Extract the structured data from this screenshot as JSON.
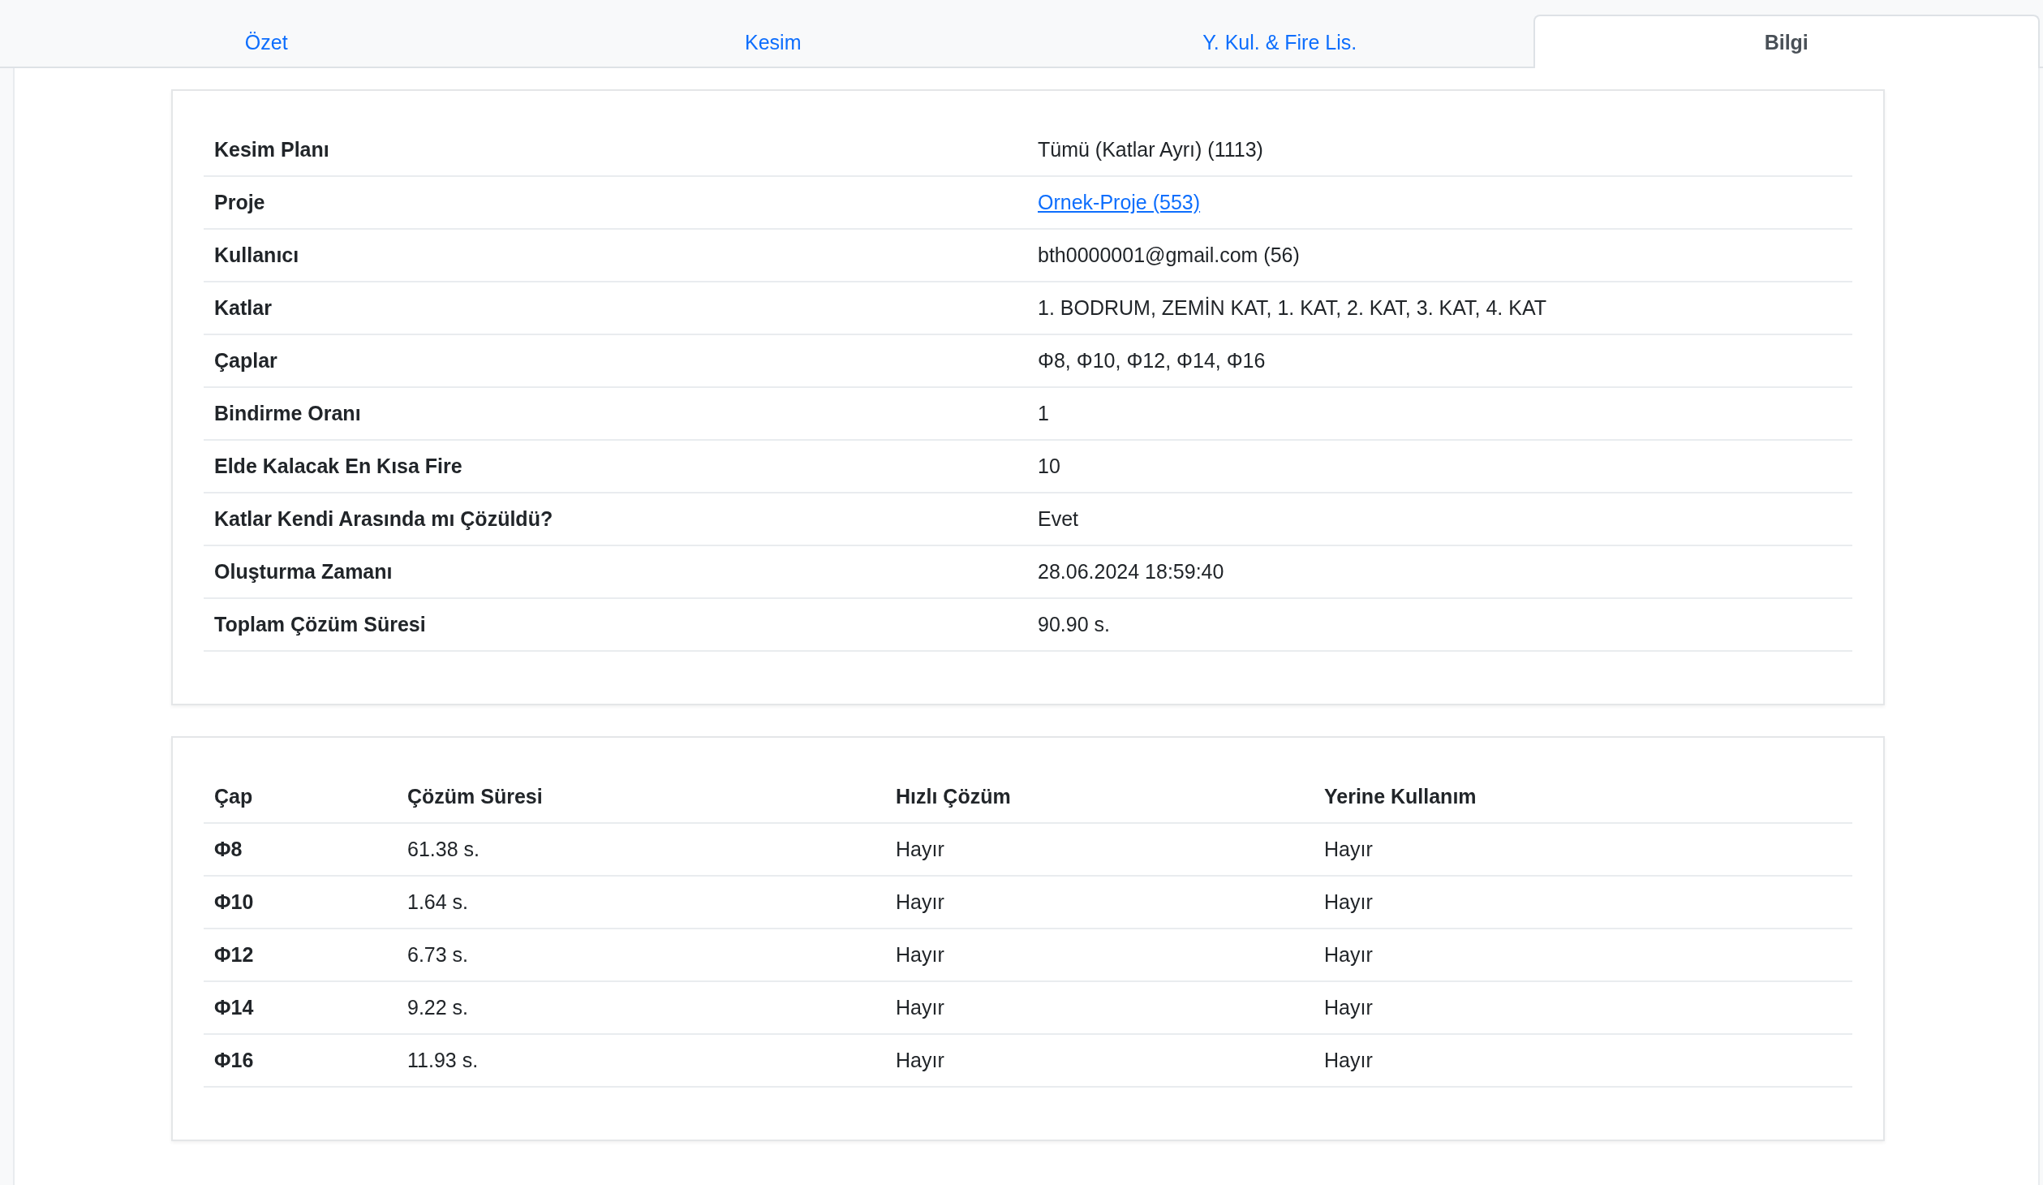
{
  "tabs": [
    {
      "label": "Özet",
      "selected": false
    },
    {
      "label": "Kesim",
      "selected": false
    },
    {
      "label": "Y. Kul. & Fire Lis.",
      "selected": false
    },
    {
      "label": "Bilgi",
      "selected": true
    }
  ],
  "info_table": {
    "rows": [
      {
        "label": "Kesim Planı",
        "value": "Tümü (Katlar Ayrı) (1113)",
        "kind": "text"
      },
      {
        "label": "Proje",
        "value": "Ornek-Proje (553)",
        "kind": "link"
      },
      {
        "label": "Kullanıcı",
        "value": "bth0000001@gmail.com (56)",
        "kind": "text"
      },
      {
        "label": "Katlar",
        "value": "1. BODRUM, ZEMİN KAT, 1. KAT, 2. KAT, 3. KAT, 4. KAT",
        "kind": "text"
      },
      {
        "label": "Çaplar",
        "value": "Φ8, Φ10, Φ12, Φ14, Φ16",
        "kind": "text"
      },
      {
        "label": "Bindirme Oranı",
        "value": "1",
        "kind": "text"
      },
      {
        "label": "Elde Kalacak En Kısa Fire",
        "value": "10",
        "kind": "text"
      },
      {
        "label": "Katlar Kendi Arasında mı Çözüldü?",
        "value": "Evet",
        "kind": "text"
      },
      {
        "label": "Oluşturma Zamanı",
        "value": "28.06.2024 18:59:40",
        "kind": "text"
      },
      {
        "label": "Toplam Çözüm Süresi",
        "value": "90.90 s.",
        "kind": "text"
      }
    ]
  },
  "diameter_table": {
    "columns": [
      "Çap",
      "Çözüm Süresi",
      "Hızlı Çözüm",
      "Yerine Kullanım"
    ],
    "rows": [
      [
        "Φ8",
        "61.38 s.",
        "Hayır",
        "Hayır"
      ],
      [
        "Φ10",
        "1.64 s.",
        "Hayır",
        "Hayır"
      ],
      [
        "Φ12",
        "6.73 s.",
        "Hayır",
        "Hayır"
      ],
      [
        "Φ14",
        "9.22 s.",
        "Hayır",
        "Hayır"
      ],
      [
        "Φ16",
        "11.93 s.",
        "Hayır",
        "Hayır"
      ]
    ]
  }
}
